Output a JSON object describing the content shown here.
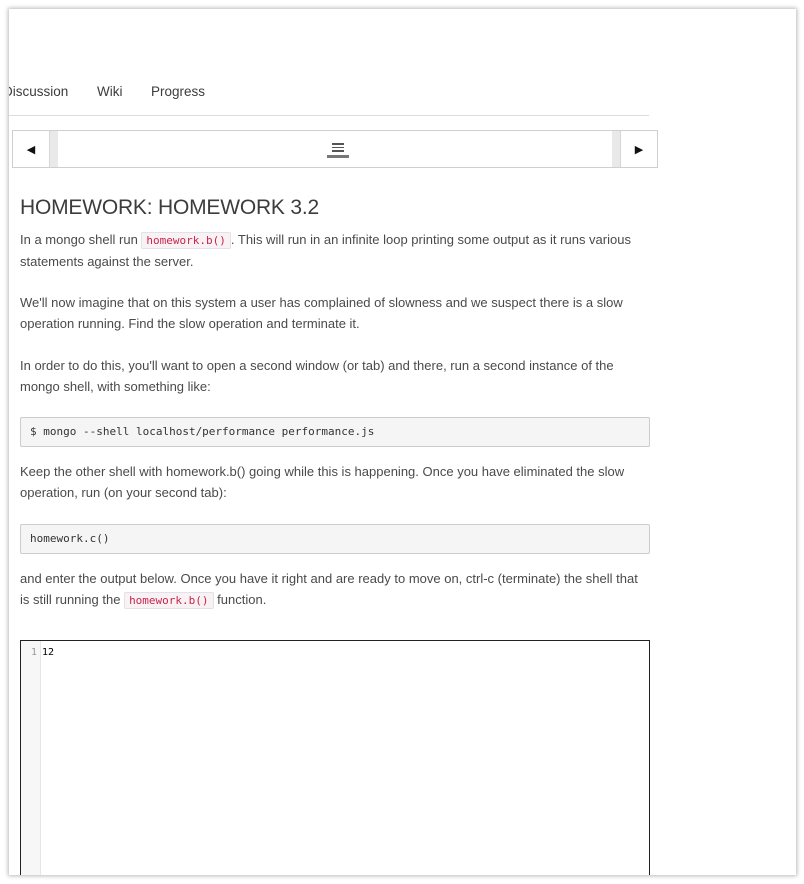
{
  "nav": {
    "tabs": [
      {
        "label": "Discussion"
      },
      {
        "label": "Wiki"
      },
      {
        "label": "Progress"
      }
    ]
  },
  "sequence": {
    "prev_icon": "triangle-left-icon",
    "next_icon": "triangle-right-icon",
    "item_icon": "list-icon"
  },
  "problem": {
    "title": "HOMEWORK: HOMEWORK 3.2",
    "p1_before": "In a mongo shell run ",
    "p1_code": "homework.b()",
    "p1_after": ". This will run in an infinite loop printing some output as it runs various statements against the server.",
    "p2": "We'll now imagine that on this system a user has complained of slowness and we suspect there is a slow operation running. Find the slow operation and terminate it.",
    "p3": "In order to do this, you'll want to open a second window (or tab) and there, run a second instance of the mongo shell, with something like:",
    "code1": "$ mongo --shell localhost/performance performance.js",
    "p4": "Keep the other shell with homework.b() going while this is happening. Once you have eliminated the slow operation, run (on your second tab):",
    "code2": "homework.c()",
    "p5_before": "and enter the output below. Once you have it right and are ready to move on, ctrl-c (terminate) the shell that is still running the ",
    "p5_code": "homework.b()",
    "p5_after": " function."
  },
  "editor": {
    "line_number": "1",
    "value": "12"
  }
}
